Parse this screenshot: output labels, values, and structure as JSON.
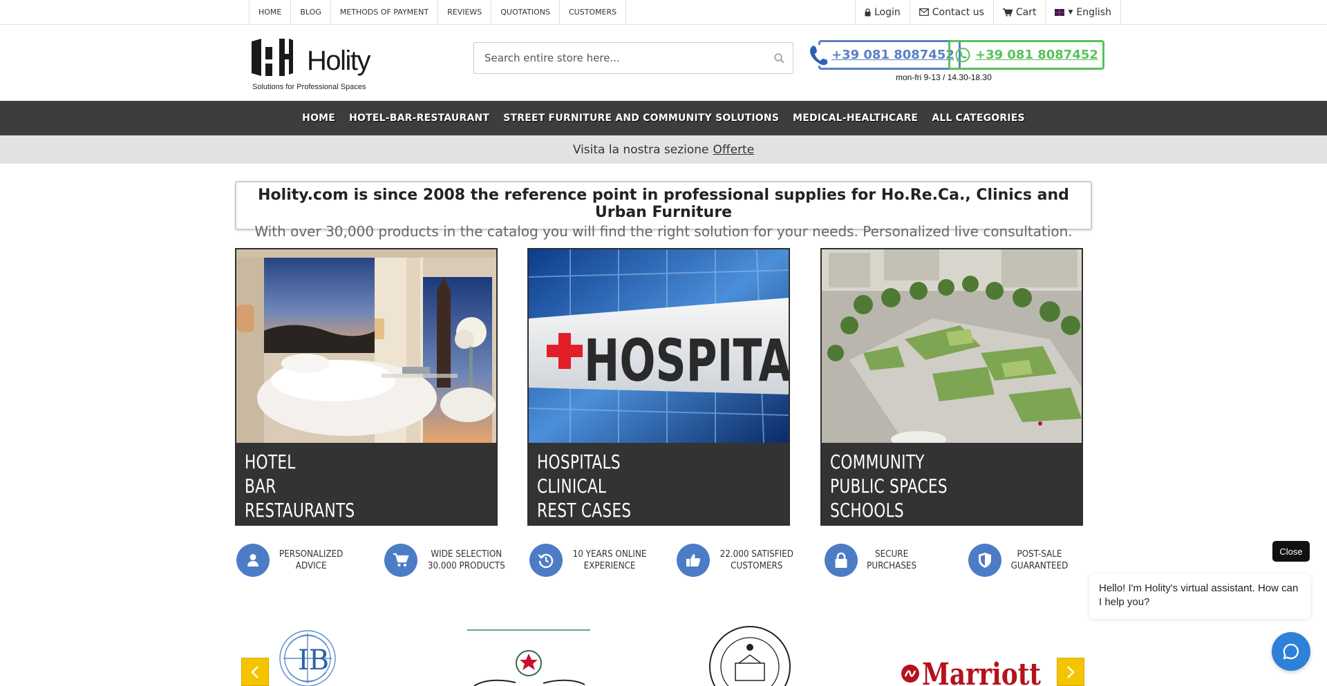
{
  "topnav": {
    "links": [
      "HOME",
      "BLOG",
      "METHODS OF PAYMENT",
      "REVIEWS",
      "QUOTATIONS",
      "CUSTOMERS"
    ],
    "login": "Login",
    "contact": "Contact us",
    "cart": "Cart",
    "language": "English"
  },
  "header": {
    "logo_name": "Holity",
    "logo_tagline": "Solutions for Professional Spaces",
    "search_placeholder": "Search entire store here...",
    "phone_blue": "+39 081 8087452",
    "phone_green": "+39 081 8087452",
    "hours": "mon-fri 9-13 / 14.30-18.30"
  },
  "mainnav": [
    "HOME",
    "HOTEL-BAR-RESTAURANT",
    "STREET FURNITURE AND COMMUNITY SOLUTIONS",
    "MEDICAL-HEALTHCARE",
    "ALL CATEGORIES"
  ],
  "promo": {
    "text": "Visita la nostra sezione",
    "link": "Offerte"
  },
  "intro": {
    "title": "Holity.com is since 2008 the reference point in professional supplies for Ho.Re.Ca., Clinics and Urban Furniture",
    "subtitle": "With over 30,000 products in the catalog you will find the right solution for your needs. Personalized live consultation."
  },
  "cards": [
    {
      "lines": [
        "HOTEL",
        "BAR",
        "RESTAURANTS"
      ]
    },
    {
      "lines": [
        "HOSPITALS",
        "CLINICAL",
        "REST CASES"
      ],
      "sign_text": "HOSPITA"
    },
    {
      "lines": [
        "COMMUNITY",
        "PUBLIC SPACES",
        "SCHOOLS"
      ]
    }
  ],
  "features": [
    {
      "line1": "PERSONALIZED",
      "line2": "ADVICE",
      "icon": "user-icon"
    },
    {
      "line1": "WIDE SELECTION",
      "line2": "30.000 PRODUCTS",
      "icon": "cart-icon"
    },
    {
      "line1": "10 YEARS ONLINE",
      "line2": "EXPERIENCE",
      "icon": "history-icon"
    },
    {
      "line1": "22.000 SATISFIED",
      "line2": "CUSTOMERS",
      "icon": "thumbs-up-icon"
    },
    {
      "line1": "SECURE",
      "line2": "PURCHASES",
      "icon": "lock-icon"
    },
    {
      "line1": "POST-SALE",
      "line2": "GUARANTEED",
      "icon": "shield-icon"
    }
  ],
  "brands": {
    "marriott": "Marriott"
  },
  "chat": {
    "close": "Close",
    "message": "Hello! I'm Holity's virtual assistant. How can I help you?"
  },
  "colors": {
    "accent_blue": "#4d7cc7",
    "phone_blue": "#5b80c4",
    "phone_green": "#57c25a",
    "nav_bg": "#3d3d3d",
    "arrow_yellow": "#f5c400",
    "marriott_red": "#b5121b"
  }
}
